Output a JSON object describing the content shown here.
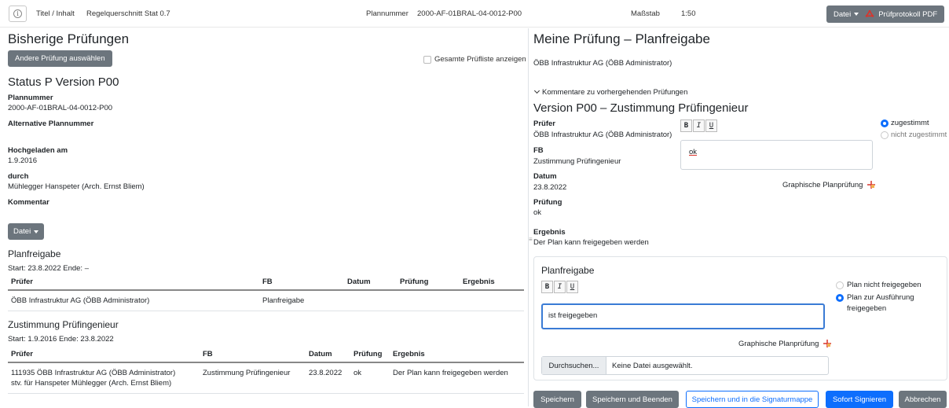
{
  "header": {
    "info_icon": "info-circle-icon",
    "titel_label": "Titel / Inhalt",
    "titel_value": "Regelquerschnitt Stat 0.7",
    "plannummer_label": "Plannummer",
    "plannummer_value": "2000-AF-01BRAL-04-0012-P00",
    "massstab_label": "Maßstab",
    "massstab_value": "1:50",
    "datei_button": "Datei",
    "pruefprotokoll_button": "Prüfprotokoll PDF"
  },
  "left": {
    "title": "Bisherige Prüfungen",
    "andere_button": "Andere Prüfung auswählen",
    "gesamte_checkbox_label": "Gesamte Prüfliste anzeigen",
    "status_title": "Status P Version P00",
    "fields": [
      {
        "label": "Plannummer",
        "value": "2000-AF-01BRAL-04-0012-P00"
      },
      {
        "label": "Alternative Plannummer",
        "value": ""
      },
      {
        "label": "Hochgeladen am",
        "value": "1.9.2016"
      },
      {
        "label": "durch",
        "value": "Mühlegger Hanspeter (Arch. Ernst Bliem)"
      },
      {
        "label": "Kommentar",
        "value": ""
      }
    ],
    "datei_button": "Datei",
    "planfreigabe": {
      "title": "Planfreigabe",
      "start": "Start:  23.8.2022 Ende:  –",
      "headers": [
        "Prüfer",
        "FB",
        "Datum",
        "Prüfung",
        "Ergebnis"
      ],
      "rows": [
        {
          "pruefer": "ÖBB Infrastruktur AG (ÖBB Administrator)",
          "fb": "Planfreigabe",
          "datum": "",
          "pruefung": "",
          "ergebnis": ""
        }
      ]
    },
    "zustimmung": {
      "title": "Zustimmung Prüfingenieur",
      "start": "Start:  1.9.2016 Ende:  23.8.2022",
      "headers": [
        "Prüfer",
        "FB",
        "Datum",
        "Prüfung",
        "Ergebnis"
      ],
      "rows": [
        {
          "pruefer": "111935 ÖBB Infrastruktur AG (ÖBB Administrator)",
          "pruefer2": "stv. für Hanspeter Mühlegger (Arch. Ernst Bliem)",
          "fb": "Zustimmung Prüfingenieur",
          "datum": "23.8.2022",
          "pruefung": "ok",
          "ergebnis": "Der Plan kann freigegeben werden"
        }
      ]
    }
  },
  "right": {
    "title": "Meine Prüfung – Planfreigabe",
    "org": "ÖBB Infrastruktur AG (ÖBB Administrator)",
    "kommentare_toggle": "Kommentare zu vorhergehenden Prüfungen",
    "version_title": "Version P00 – Zustimmung Prüfingenieur",
    "pruefer_label": "Prüfer",
    "pruefer_value": "ÖBB Infrastruktur AG (ÖBB Administrator)",
    "fb_label": "FB",
    "fb_value": "Zustimmung Prüfingenieur",
    "datum_label": "Datum",
    "datum_value": "23.8.2022",
    "pruefung_label": "Prüfung",
    "pruefung_value": "ok",
    "ergebnis_label": "Ergebnis",
    "ergebnis_value": "Der Plan kann freigegeben werden",
    "comment_text": "ok",
    "radio_zugestimmt": "zugestimmt",
    "radio_nicht_zugestimmt": "nicht zugestimmt",
    "graphische_link": "Graphische Planprüfung",
    "fmt_bold": "B",
    "fmt_italic": "I",
    "fmt_underline": "U",
    "planfreigabe_card": {
      "title": "Planfreigabe",
      "text": "ist freigegeben",
      "radio_nicht": "Plan nicht freigegeben",
      "radio_ausfuehrung_1": "Plan zur Ausführung",
      "radio_ausfuehrung_2": "freigegeben",
      "graphische_link": "Graphische Planprüfung",
      "file_button": "Durchsuchen...",
      "file_value": "Keine Datei ausgewählt."
    },
    "buttons": {
      "speichern": "Speichern",
      "speichern_beenden": "Speichern und Beenden",
      "signaturmappe": "Speichern und in die Signaturmappe",
      "sofort": "Sofort Signieren",
      "abbrechen": "Abbrechen"
    },
    "grip": "≡"
  },
  "colors": {
    "primary": "#0d6efd",
    "secondary": "#6c757d",
    "pdf_red": "#d9342b"
  }
}
